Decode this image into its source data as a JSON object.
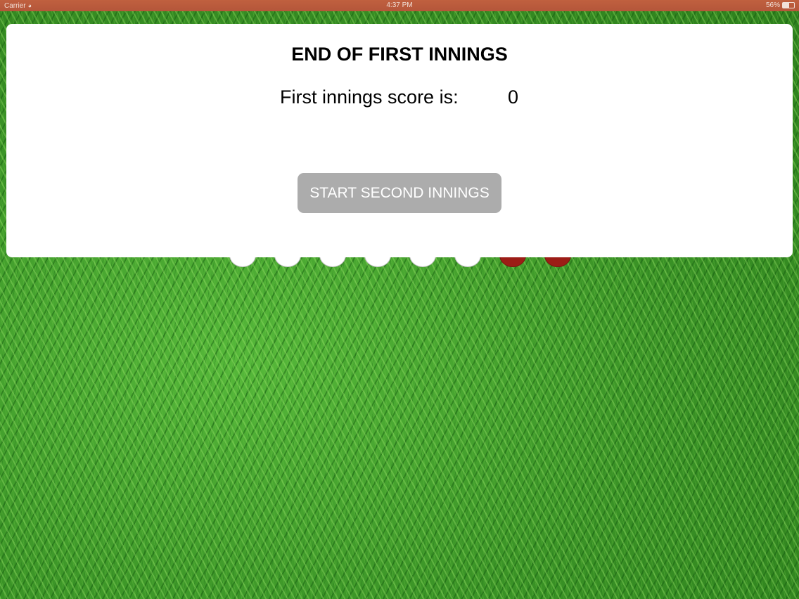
{
  "status_bar": {
    "carrier": "Carrier",
    "wifi_icon": "wifi-icon",
    "time": "4:37 PM",
    "battery_percent": "56%",
    "battery_level": 0.56
  },
  "dialog": {
    "title": "END OF FIRST INNINGS",
    "score_label": "First innings score is:",
    "score_value": "0",
    "start_button_label": "START SECOND INNINGS"
  },
  "background": {
    "image": "grass-field"
  },
  "balls": [
    {
      "color": "white"
    },
    {
      "color": "white"
    },
    {
      "color": "white"
    },
    {
      "color": "white"
    },
    {
      "color": "white"
    },
    {
      "color": "white"
    },
    {
      "color": "red"
    },
    {
      "color": "red"
    }
  ],
  "colors": {
    "status_bar": "#b4563a",
    "button": "#acacac",
    "dialog": "#ffffff",
    "grass": "#3f9a2a"
  }
}
